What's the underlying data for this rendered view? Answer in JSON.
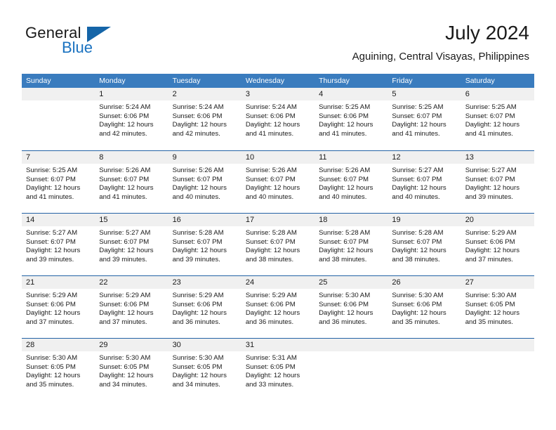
{
  "brand": {
    "word1": "General",
    "word2": "Blue",
    "logo_icon": "triangle-logo-icon",
    "accent_color": "#1a72c0"
  },
  "header": {
    "month_title": "July 2024",
    "location": "Aguining, Central Visayas, Philippines"
  },
  "calendar": {
    "header_bg": "#3a7cbe",
    "row_divider_color": "#2463a6",
    "day_band_bg": "#f0f0f0",
    "weekdays": [
      "Sunday",
      "Monday",
      "Tuesday",
      "Wednesday",
      "Thursday",
      "Friday",
      "Saturday"
    ],
    "weeks": [
      [
        {
          "day": "",
          "empty": true
        },
        {
          "day": "1",
          "sunrise": "Sunrise: 5:24 AM",
          "sunset": "Sunset: 6:06 PM",
          "daylight_line1": "Daylight: 12 hours",
          "daylight_line2": "and 42 minutes."
        },
        {
          "day": "2",
          "sunrise": "Sunrise: 5:24 AM",
          "sunset": "Sunset: 6:06 PM",
          "daylight_line1": "Daylight: 12 hours",
          "daylight_line2": "and 42 minutes."
        },
        {
          "day": "3",
          "sunrise": "Sunrise: 5:24 AM",
          "sunset": "Sunset: 6:06 PM",
          "daylight_line1": "Daylight: 12 hours",
          "daylight_line2": "and 41 minutes."
        },
        {
          "day": "4",
          "sunrise": "Sunrise: 5:25 AM",
          "sunset": "Sunset: 6:06 PM",
          "daylight_line1": "Daylight: 12 hours",
          "daylight_line2": "and 41 minutes."
        },
        {
          "day": "5",
          "sunrise": "Sunrise: 5:25 AM",
          "sunset": "Sunset: 6:07 PM",
          "daylight_line1": "Daylight: 12 hours",
          "daylight_line2": "and 41 minutes."
        },
        {
          "day": "6",
          "sunrise": "Sunrise: 5:25 AM",
          "sunset": "Sunset: 6:07 PM",
          "daylight_line1": "Daylight: 12 hours",
          "daylight_line2": "and 41 minutes."
        }
      ],
      [
        {
          "day": "7",
          "sunrise": "Sunrise: 5:25 AM",
          "sunset": "Sunset: 6:07 PM",
          "daylight_line1": "Daylight: 12 hours",
          "daylight_line2": "and 41 minutes."
        },
        {
          "day": "8",
          "sunrise": "Sunrise: 5:26 AM",
          "sunset": "Sunset: 6:07 PM",
          "daylight_line1": "Daylight: 12 hours",
          "daylight_line2": "and 41 minutes."
        },
        {
          "day": "9",
          "sunrise": "Sunrise: 5:26 AM",
          "sunset": "Sunset: 6:07 PM",
          "daylight_line1": "Daylight: 12 hours",
          "daylight_line2": "and 40 minutes."
        },
        {
          "day": "10",
          "sunrise": "Sunrise: 5:26 AM",
          "sunset": "Sunset: 6:07 PM",
          "daylight_line1": "Daylight: 12 hours",
          "daylight_line2": "and 40 minutes."
        },
        {
          "day": "11",
          "sunrise": "Sunrise: 5:26 AM",
          "sunset": "Sunset: 6:07 PM",
          "daylight_line1": "Daylight: 12 hours",
          "daylight_line2": "and 40 minutes."
        },
        {
          "day": "12",
          "sunrise": "Sunrise: 5:27 AM",
          "sunset": "Sunset: 6:07 PM",
          "daylight_line1": "Daylight: 12 hours",
          "daylight_line2": "and 40 minutes."
        },
        {
          "day": "13",
          "sunrise": "Sunrise: 5:27 AM",
          "sunset": "Sunset: 6:07 PM",
          "daylight_line1": "Daylight: 12 hours",
          "daylight_line2": "and 39 minutes."
        }
      ],
      [
        {
          "day": "14",
          "sunrise": "Sunrise: 5:27 AM",
          "sunset": "Sunset: 6:07 PM",
          "daylight_line1": "Daylight: 12 hours",
          "daylight_line2": "and 39 minutes."
        },
        {
          "day": "15",
          "sunrise": "Sunrise: 5:27 AM",
          "sunset": "Sunset: 6:07 PM",
          "daylight_line1": "Daylight: 12 hours",
          "daylight_line2": "and 39 minutes."
        },
        {
          "day": "16",
          "sunrise": "Sunrise: 5:28 AM",
          "sunset": "Sunset: 6:07 PM",
          "daylight_line1": "Daylight: 12 hours",
          "daylight_line2": "and 39 minutes."
        },
        {
          "day": "17",
          "sunrise": "Sunrise: 5:28 AM",
          "sunset": "Sunset: 6:07 PM",
          "daylight_line1": "Daylight: 12 hours",
          "daylight_line2": "and 38 minutes."
        },
        {
          "day": "18",
          "sunrise": "Sunrise: 5:28 AM",
          "sunset": "Sunset: 6:07 PM",
          "daylight_line1": "Daylight: 12 hours",
          "daylight_line2": "and 38 minutes."
        },
        {
          "day": "19",
          "sunrise": "Sunrise: 5:28 AM",
          "sunset": "Sunset: 6:07 PM",
          "daylight_line1": "Daylight: 12 hours",
          "daylight_line2": "and 38 minutes."
        },
        {
          "day": "20",
          "sunrise": "Sunrise: 5:29 AM",
          "sunset": "Sunset: 6:06 PM",
          "daylight_line1": "Daylight: 12 hours",
          "daylight_line2": "and 37 minutes."
        }
      ],
      [
        {
          "day": "21",
          "sunrise": "Sunrise: 5:29 AM",
          "sunset": "Sunset: 6:06 PM",
          "daylight_line1": "Daylight: 12 hours",
          "daylight_line2": "and 37 minutes."
        },
        {
          "day": "22",
          "sunrise": "Sunrise: 5:29 AM",
          "sunset": "Sunset: 6:06 PM",
          "daylight_line1": "Daylight: 12 hours",
          "daylight_line2": "and 37 minutes."
        },
        {
          "day": "23",
          "sunrise": "Sunrise: 5:29 AM",
          "sunset": "Sunset: 6:06 PM",
          "daylight_line1": "Daylight: 12 hours",
          "daylight_line2": "and 36 minutes."
        },
        {
          "day": "24",
          "sunrise": "Sunrise: 5:29 AM",
          "sunset": "Sunset: 6:06 PM",
          "daylight_line1": "Daylight: 12 hours",
          "daylight_line2": "and 36 minutes."
        },
        {
          "day": "25",
          "sunrise": "Sunrise: 5:30 AM",
          "sunset": "Sunset: 6:06 PM",
          "daylight_line1": "Daylight: 12 hours",
          "daylight_line2": "and 36 minutes."
        },
        {
          "day": "26",
          "sunrise": "Sunrise: 5:30 AM",
          "sunset": "Sunset: 6:06 PM",
          "daylight_line1": "Daylight: 12 hours",
          "daylight_line2": "and 35 minutes."
        },
        {
          "day": "27",
          "sunrise": "Sunrise: 5:30 AM",
          "sunset": "Sunset: 6:05 PM",
          "daylight_line1": "Daylight: 12 hours",
          "daylight_line2": "and 35 minutes."
        }
      ],
      [
        {
          "day": "28",
          "sunrise": "Sunrise: 5:30 AM",
          "sunset": "Sunset: 6:05 PM",
          "daylight_line1": "Daylight: 12 hours",
          "daylight_line2": "and 35 minutes."
        },
        {
          "day": "29",
          "sunrise": "Sunrise: 5:30 AM",
          "sunset": "Sunset: 6:05 PM",
          "daylight_line1": "Daylight: 12 hours",
          "daylight_line2": "and 34 minutes."
        },
        {
          "day": "30",
          "sunrise": "Sunrise: 5:30 AM",
          "sunset": "Sunset: 6:05 PM",
          "daylight_line1": "Daylight: 12 hours",
          "daylight_line2": "and 34 minutes."
        },
        {
          "day": "31",
          "sunrise": "Sunrise: 5:31 AM",
          "sunset": "Sunset: 6:05 PM",
          "daylight_line1": "Daylight: 12 hours",
          "daylight_line2": "and 33 minutes."
        },
        {
          "day": "",
          "empty": true
        },
        {
          "day": "",
          "empty": true
        },
        {
          "day": "",
          "empty": true
        }
      ]
    ]
  }
}
